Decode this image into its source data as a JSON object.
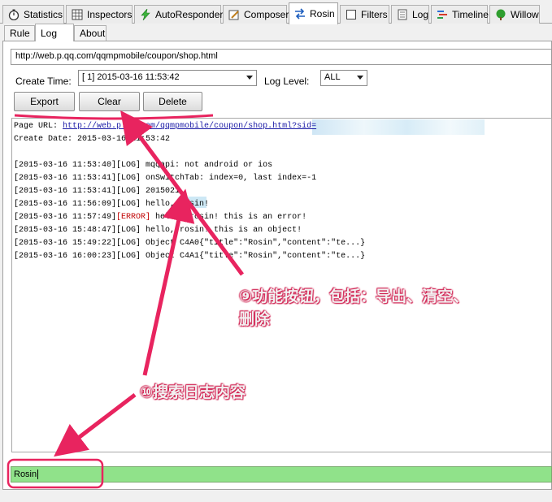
{
  "tabs": [
    {
      "label": "Statistics",
      "icon": "stopwatch-icon"
    },
    {
      "label": "Inspectors",
      "icon": "inspectors-icon"
    },
    {
      "label": "AutoResponder",
      "icon": "lightning-icon"
    },
    {
      "label": "Composer",
      "icon": "composer-icon"
    },
    {
      "label": "Rosin",
      "icon": "rosin-arrows-icon"
    },
    {
      "label": "Filters",
      "icon": "checkbox-icon"
    },
    {
      "label": "Log",
      "icon": "log-icon"
    },
    {
      "label": "Timeline",
      "icon": "timeline-icon"
    },
    {
      "label": "Willow",
      "icon": "tree-icon"
    }
  ],
  "subtabs": [
    "Rule",
    "Log",
    "About"
  ],
  "url_field": "http://web.p.qq.com/qqmpmobile/coupon/shop.html",
  "create_time_label": "Create Time:",
  "create_time_value": "[ 1] 2015-03-16 11:53:42",
  "log_level_label": "Log Level:",
  "log_level_value": "ALL",
  "buttons": {
    "export": "Export",
    "clear": "Clear",
    "delete": "Delete"
  },
  "log": {
    "page_url_label": "Page URL:",
    "page_url": "http://web.p.qq.com/qqmpmobile/coupon/shop.html?sid=",
    "create_date": "Create Date: 2015-03-16 11:53:42",
    "lines": [
      {
        "ts": "[2015-03-16 11:53:40]",
        "level": "[LOG]",
        "msg": " mqqapi: not android or ios"
      },
      {
        "ts": "[2015-03-16 11:53:41]",
        "level": "[LOG]",
        "msg": " onSwitchTab: index=0, last index=-1"
      },
      {
        "ts": "[2015-03-16 11:53:41]",
        "level": "[LOG]",
        "msg": " 2015021"
      },
      {
        "ts": "[2015-03-16 11:56:09]",
        "level": "[LOG]",
        "msg": " hello, rosin!"
      },
      {
        "ts": "[2015-03-16 11:57:49]",
        "level": "[ERROR]",
        "msg": " hello, rosin! this is an error!"
      },
      {
        "ts": "[2015-03-16 15:48:47]",
        "level": "[LOG]",
        "msg": " hello, rosin! this is an object!"
      },
      {
        "ts": "[2015-03-16 15:49:22]",
        "level": "[LOG]",
        "msg": " Object C4A0{\"title\":\"Rosin\",\"content\":\"te...}"
      },
      {
        "ts": "[2015-03-16 16:00:23]",
        "level": "[LOG]",
        "msg": " Object C4A1{\"title\":\"Rosin\",\"content\":\"te...}"
      }
    ]
  },
  "search_value": "Rosin",
  "annotations": {
    "buttons_note_line1": "⑨功能按钮，包括：导出、清空、",
    "buttons_note_line2": "删除",
    "search_note": "⑩搜索日志内容"
  },
  "colors": {
    "accent": "#e8245f",
    "search_bg": "#90e28a",
    "error": "#c00000"
  }
}
